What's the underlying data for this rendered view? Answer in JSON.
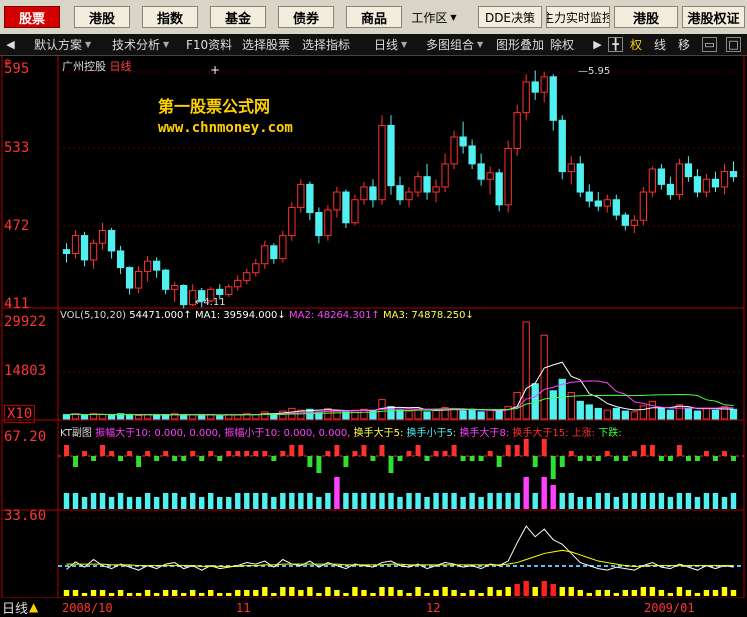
{
  "top_buttons": [
    "股票",
    "港股",
    "指数",
    "基金",
    "债券",
    "商品",
    "工作区",
    "DDE决策",
    "主力实时监控",
    "港股",
    "港股权证"
  ],
  "toolbar": {
    "scheme": "默认方案",
    "analysis": "技术分析",
    "f10": "F10资料",
    "select_stock": "选择股票",
    "select_indicator": "选择指标",
    "period": "日线",
    "multi": "多图组合",
    "overlay": "图形叠加",
    "misc": "除权",
    "quan": "权",
    "xian": "线",
    "yi": "移"
  },
  "stock": {
    "name": "广州控股",
    "period": "日线"
  },
  "watermark": {
    "line1": "第一股票公式网",
    "line2": "www.chnmoney.com"
  },
  "price_axis": [
    "595",
    "533",
    "472",
    "411"
  ],
  "vol_axis": [
    "29922",
    "14803",
    "X10"
  ],
  "kt_axis": [
    "67.20",
    "33.60"
  ],
  "high_label": "5.95",
  "low_label": "4.11",
  "vol_line": {
    "title": "VOL(5,10,20)",
    "v": "54471.000↑",
    "ma1": "MA1: 39594.000↓",
    "ma2": "MA2: 48264.301↑",
    "ma3": "MA3: 74878.250↓"
  },
  "kt_line": {
    "title": "KT副图",
    "a": "振幅大于10: 0.000, 0.000,",
    "b": "振幅小于10: 0.000, 0.000,",
    "c": "换手大于5:",
    "d": "换手小于5:",
    "e": "换手大于8:",
    "f": "换手大于15:",
    "g": "上涨:",
    "h": "下跌:"
  },
  "x_labels": [
    "2008/10",
    "11",
    "12",
    "2009/01"
  ],
  "bottom_tab": "日线",
  "colors": {
    "up": "#ff3030",
    "down": "#50f0f0",
    "bg": "#000000",
    "axis": "#b00000",
    "ma1": "#ffffff",
    "ma2": "#ff40ff",
    "ma3": "#ffff40",
    "vol": "#40ff40",
    "kt": "#ffffff",
    "yellow": "#ffff00"
  },
  "chart_data": {
    "type": "candlestick",
    "price_range": [
      411,
      600
    ],
    "candles": [
      [
        455,
        460,
        445,
        452
      ],
      [
        452,
        470,
        448,
        466
      ],
      [
        466,
        469,
        442,
        447
      ],
      [
        447,
        463,
        440,
        460
      ],
      [
        460,
        476,
        455,
        470
      ],
      [
        470,
        472,
        448,
        454
      ],
      [
        454,
        458,
        436,
        441
      ],
      [
        441,
        442,
        420,
        425
      ],
      [
        425,
        442,
        421,
        438
      ],
      [
        438,
        450,
        430,
        446
      ],
      [
        446,
        449,
        433,
        439
      ],
      [
        439,
        440,
        420,
        424
      ],
      [
        424,
        430,
        414,
        427
      ],
      [
        427,
        428,
        409,
        412
      ],
      [
        412,
        428,
        411,
        423
      ],
      [
        423,
        425,
        410,
        415
      ],
      [
        415,
        426,
        414,
        424
      ],
      [
        424,
        428,
        416,
        420
      ],
      [
        420,
        428,
        418,
        426
      ],
      [
        426,
        435,
        423,
        431
      ],
      [
        431,
        440,
        428,
        437
      ],
      [
        437,
        448,
        434,
        444
      ],
      [
        444,
        462,
        440,
        458
      ],
      [
        458,
        460,
        444,
        448
      ],
      [
        448,
        470,
        445,
        466
      ],
      [
        466,
        492,
        462,
        488
      ],
      [
        488,
        510,
        484,
        506
      ],
      [
        506,
        508,
        478,
        484
      ],
      [
        484,
        488,
        460,
        466
      ],
      [
        466,
        490,
        462,
        486
      ],
      [
        486,
        504,
        480,
        500
      ],
      [
        500,
        502,
        472,
        476
      ],
      [
        476,
        498,
        474,
        494
      ],
      [
        494,
        508,
        490,
        504
      ],
      [
        504,
        510,
        488,
        494
      ],
      [
        494,
        560,
        490,
        552
      ],
      [
        552,
        560,
        498,
        505
      ],
      [
        505,
        512,
        490,
        494
      ],
      [
        494,
        504,
        488,
        500
      ],
      [
        500,
        516,
        496,
        512
      ],
      [
        512,
        522,
        494,
        500
      ],
      [
        500,
        510,
        492,
        504
      ],
      [
        504,
        530,
        500,
        522
      ],
      [
        522,
        548,
        518,
        543
      ],
      [
        543,
        555,
        530,
        536
      ],
      [
        536,
        541,
        518,
        522
      ],
      [
        522,
        530,
        505,
        510
      ],
      [
        510,
        520,
        498,
        515
      ],
      [
        515,
        518,
        485,
        490
      ],
      [
        490,
        540,
        484,
        534
      ],
      [
        534,
        568,
        528,
        562
      ],
      [
        562,
        592,
        556,
        586
      ],
      [
        586,
        595,
        572,
        578
      ],
      [
        578,
        594,
        570,
        590
      ],
      [
        590,
        592,
        548,
        556
      ],
      [
        556,
        560,
        510,
        516
      ],
      [
        516,
        528,
        506,
        522
      ],
      [
        522,
        528,
        496,
        500
      ],
      [
        500,
        506,
        488,
        493
      ],
      [
        493,
        500,
        485,
        489
      ],
      [
        489,
        498,
        484,
        494
      ],
      [
        494,
        498,
        478,
        482
      ],
      [
        482,
        484,
        470,
        474
      ],
      [
        474,
        482,
        468,
        478
      ],
      [
        478,
        504,
        474,
        500
      ],
      [
        500,
        520,
        496,
        518
      ],
      [
        518,
        522,
        502,
        506
      ],
      [
        506,
        512,
        494,
        498
      ],
      [
        498,
        526,
        494,
        522
      ],
      [
        522,
        528,
        508,
        512
      ],
      [
        512,
        518,
        496,
        500
      ],
      [
        500,
        514,
        496,
        510
      ],
      [
        510,
        516,
        500,
        504
      ],
      [
        504,
        522,
        498,
        516
      ],
      [
        516,
        524,
        508,
        512
      ]
    ],
    "ma1": [
      455,
      456,
      458,
      457,
      458,
      460,
      458,
      453,
      448,
      445,
      441,
      437,
      434,
      432,
      426,
      422,
      421,
      421,
      421,
      423,
      426,
      430,
      437,
      442,
      447,
      455,
      469,
      478,
      482,
      482,
      485,
      488,
      487,
      490,
      492,
      504,
      509,
      510,
      511,
      511,
      506,
      507,
      508,
      515,
      524,
      527,
      526,
      519,
      512,
      510,
      520,
      531,
      544,
      558,
      575,
      576,
      569,
      560,
      549,
      532,
      511,
      500,
      492,
      486,
      484,
      486,
      492,
      497,
      502,
      510,
      514,
      513,
      511,
      512,
      511
    ],
    "ma2": [
      470,
      469,
      468,
      467,
      466,
      465,
      464,
      462,
      460,
      458,
      456,
      453,
      450,
      447,
      443,
      440,
      437,
      434,
      431,
      429,
      428,
      427,
      428,
      430,
      432,
      436,
      442,
      448,
      454,
      458,
      462,
      466,
      470,
      474,
      478,
      483,
      488,
      492,
      496,
      498,
      500,
      501,
      502,
      504,
      507,
      510,
      513,
      516,
      518,
      520,
      522,
      525,
      530,
      535,
      540,
      545,
      548,
      548,
      546,
      542,
      536,
      530,
      524,
      518,
      512,
      508,
      504,
      502,
      500,
      500,
      502,
      504,
      506,
      508,
      510
    ],
    "ma3": [
      480,
      479,
      478,
      477,
      476,
      475,
      474,
      473,
      471,
      469,
      467,
      465,
      462,
      459,
      456,
      453,
      450,
      447,
      444,
      441,
      439,
      437,
      435,
      434,
      433,
      433,
      434,
      435,
      437,
      439,
      441,
      443,
      446,
      449,
      452,
      455,
      458,
      461,
      464,
      467,
      470,
      473,
      476,
      479,
      482,
      485,
      488,
      490,
      492,
      494,
      496,
      498,
      500,
      503,
      506,
      509,
      512,
      514,
      515,
      516,
      516,
      516,
      515,
      514,
      512,
      511,
      510,
      509,
      508,
      508,
      508,
      508,
      508,
      508,
      508
    ],
    "volume": [
      5,
      6,
      4,
      6,
      5,
      4,
      6,
      5,
      4,
      5,
      4,
      5,
      6,
      4,
      5,
      4,
      5,
      4,
      5,
      5,
      6,
      5,
      8,
      6,
      9,
      12,
      10,
      11,
      8,
      12,
      9,
      8,
      10,
      11,
      9,
      22,
      14,
      10,
      9,
      11,
      8,
      10,
      13,
      12,
      9,
      11,
      8,
      10,
      9,
      14,
      30,
      110,
      40,
      95,
      32,
      45,
      30,
      20,
      16,
      12,
      10,
      12,
      9,
      8,
      15,
      20,
      12,
      10,
      16,
      12,
      9,
      12,
      10,
      14,
      11
    ],
    "vol_range": [
      0,
      30000
    ],
    "kt_top": [
      [
        1,
        1
      ],
      [
        -1,
        1
      ],
      [
        1,
        0
      ],
      [
        -1,
        0
      ],
      [
        1,
        1
      ],
      [
        1,
        0
      ],
      [
        -1,
        0
      ],
      [
        1,
        0
      ],
      [
        -1,
        1
      ],
      [
        1,
        0
      ],
      [
        -1,
        0
      ],
      [
        1,
        0
      ],
      [
        -1,
        0
      ],
      [
        -1,
        0
      ],
      [
        1,
        0
      ],
      [
        -1,
        0
      ],
      [
        1,
        0
      ],
      [
        -1,
        0
      ],
      [
        1,
        0
      ],
      [
        1,
        0
      ],
      [
        1,
        0
      ],
      [
        1,
        0
      ],
      [
        1,
        0
      ],
      [
        -1,
        0
      ],
      [
        1,
        0
      ],
      [
        1,
        1
      ],
      [
        1,
        1
      ],
      [
        -1,
        1
      ],
      [
        -1,
        2
      ],
      [
        1,
        0
      ],
      [
        1,
        1
      ],
      [
        -1,
        1
      ],
      [
        1,
        0
      ],
      [
        1,
        1
      ],
      [
        -1,
        0
      ],
      [
        1,
        1
      ],
      [
        -1,
        2
      ],
      [
        -1,
        0
      ],
      [
        1,
        0
      ],
      [
        1,
        1
      ],
      [
        -1,
        0
      ],
      [
        1,
        0
      ],
      [
        1,
        0
      ],
      [
        1,
        1
      ],
      [
        -1,
        0
      ],
      [
        -1,
        0
      ],
      [
        -1,
        0
      ],
      [
        1,
        0
      ],
      [
        -1,
        1
      ],
      [
        1,
        1
      ],
      [
        1,
        1
      ],
      [
        1,
        2
      ],
      [
        -1,
        1
      ],
      [
        1,
        2
      ],
      [
        -1,
        3
      ],
      [
        -1,
        1
      ],
      [
        1,
        0
      ],
      [
        -1,
        0
      ],
      [
        -1,
        0
      ],
      [
        -1,
        0
      ],
      [
        1,
        0
      ],
      [
        -1,
        0
      ],
      [
        -1,
        0
      ],
      [
        1,
        0
      ],
      [
        1,
        1
      ],
      [
        1,
        1
      ],
      [
        -1,
        0
      ],
      [
        -1,
        0
      ],
      [
        1,
        1
      ],
      [
        -1,
        0
      ],
      [
        -1,
        0
      ],
      [
        1,
        0
      ],
      [
        -1,
        0
      ],
      [
        1,
        0
      ],
      [
        -1,
        0
      ]
    ],
    "turnover": [
      4,
      4,
      3,
      4,
      4,
      3,
      4,
      3,
      3,
      4,
      3,
      4,
      4,
      3,
      4,
      3,
      4,
      3,
      3,
      4,
      4,
      4,
      4,
      3,
      4,
      4,
      4,
      4,
      3,
      4,
      8,
      4,
      4,
      4,
      4,
      4,
      4,
      3,
      4,
      4,
      3,
      4,
      4,
      4,
      3,
      4,
      3,
      4,
      4,
      4,
      4,
      8,
      4,
      8,
      6,
      4,
      4,
      3,
      3,
      4,
      4,
      3,
      4,
      4,
      4,
      4,
      4,
      3,
      4,
      4,
      3,
      4,
      4,
      3,
      4
    ],
    "kt_low": [
      35,
      45,
      38,
      48,
      40,
      36,
      42,
      38,
      34,
      40,
      36,
      42,
      44,
      36,
      40,
      34,
      40,
      36,
      38,
      40,
      44,
      42,
      46,
      38,
      48,
      42,
      40,
      46,
      38,
      44,
      40,
      36,
      42,
      40,
      38,
      44,
      46,
      40,
      38,
      42,
      36,
      40,
      44,
      42,
      38,
      40,
      36,
      42,
      40,
      46,
      70,
      92,
      78,
      88,
      74,
      68,
      56,
      44,
      40,
      36,
      34,
      38,
      36,
      34,
      40,
      44,
      38,
      36,
      42,
      38,
      34,
      40,
      36,
      40,
      38
    ],
    "kt_ma": [
      42,
      42,
      42,
      42,
      42,
      41,
      41,
      41,
      40,
      40,
      40,
      40,
      40,
      40,
      40,
      39,
      39,
      39,
      39,
      39,
      40,
      40,
      41,
      41,
      42,
      42,
      42,
      42,
      42,
      42,
      42,
      41,
      41,
      41,
      41,
      41,
      42,
      42,
      41,
      41,
      41,
      41,
      41,
      41,
      41,
      41,
      41,
      41,
      41,
      42,
      44,
      48,
      52,
      56,
      58,
      60,
      58,
      54,
      50,
      46,
      44,
      42,
      40,
      39,
      39,
      40,
      40,
      40,
      40,
      40,
      40,
      40,
      40,
      40,
      40
    ],
    "kt_yellow": [
      2,
      2,
      1,
      2,
      2,
      1,
      2,
      1,
      1,
      2,
      1,
      2,
      2,
      1,
      2,
      1,
      2,
      1,
      1,
      2,
      2,
      2,
      3,
      1,
      3,
      3,
      2,
      3,
      1,
      3,
      2,
      1,
      3,
      2,
      1,
      3,
      3,
      2,
      1,
      3,
      1,
      2,
      3,
      2,
      1,
      2,
      1,
      3,
      2,
      3,
      4,
      5,
      3,
      5,
      4,
      3,
      3,
      2,
      1,
      2,
      2,
      1,
      2,
      2,
      3,
      3,
      2,
      1,
      3,
      2,
      1,
      2,
      2,
      3,
      2
    ]
  }
}
